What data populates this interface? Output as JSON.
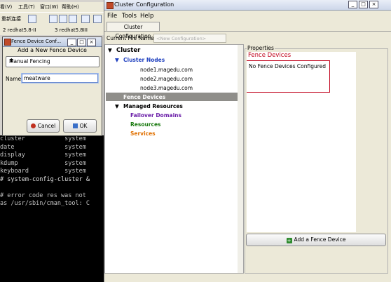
{
  "host": {
    "menubar": [
      "看(V)",
      "工具(T)",
      "窗口(W)",
      "帮助(H)"
    ],
    "toolbar_label": "重新连接",
    "tabs": [
      "2 redhat5.8-II",
      "3 redhat5.8III"
    ]
  },
  "terminal": {
    "lines": [
      "cluster           system",
      "date              system",
      "display           system",
      "kdump             system",
      "keyboard          system",
      "# system-config-cluster &",
      "",
      "# error code res was not",
      "as /usr/sbin/cman_tool: C"
    ]
  },
  "fence_dialog": {
    "title": "Fence Device Conf...",
    "heading": "Add a New Fence Device",
    "type_selected": "Manual Fencing",
    "name_label": "Name:",
    "name_value": "meatware",
    "cancel_label": "Cancel",
    "ok_label": "OK"
  },
  "cluster_window": {
    "title": "Cluster Configuration",
    "menu": [
      "File",
      "Tools",
      "Help"
    ],
    "tab": "Cluster Configuration",
    "file_label": "Current File Name:",
    "file_placeholder": "<New Configuration>",
    "tree": {
      "root": "Cluster",
      "nodes_label": "Cluster Nodes",
      "nodes": [
        "node1.magedu.com",
        "node2.magedu.com",
        "node3.magedu.com"
      ],
      "fence_devices": "Fence Devices",
      "managed_resources": "Managed Resources",
      "failover_domains": "Failover Domains",
      "resources": "Resources",
      "services": "Services"
    },
    "properties": {
      "legend": "Properties",
      "heading": "Fence Devices",
      "message": "No Fence Devices Configured",
      "add_button": "Add a Fence Device"
    }
  },
  "colors": {
    "nodes_blue": "#1e3fbf",
    "failover_purple": "#6a1ea8",
    "resources_green": "#1a7a10",
    "services_orange": "#e07000",
    "fence_red": "#c0001a"
  }
}
